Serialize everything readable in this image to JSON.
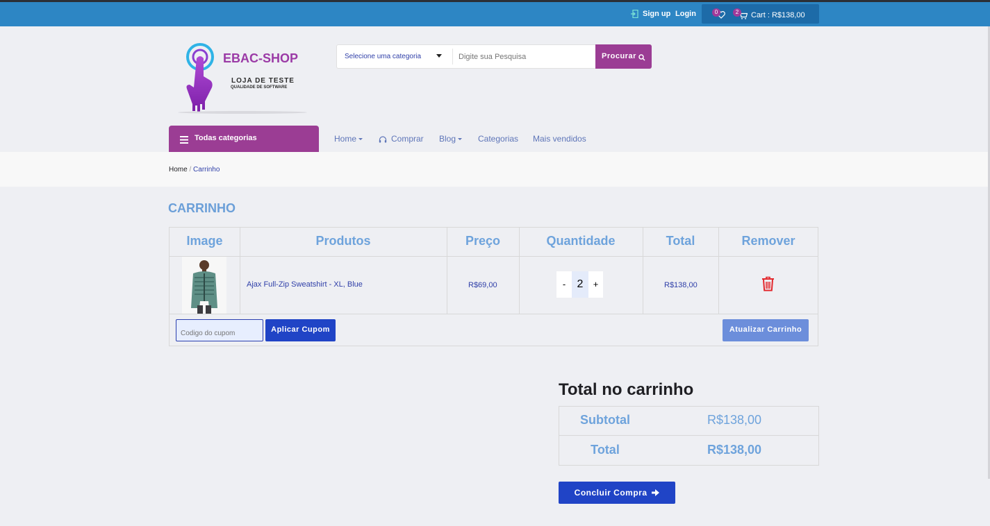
{
  "topbar": {
    "signup_label": "Sign up",
    "login_label": "Login",
    "wishlist_count": "0",
    "cart_count": "2",
    "cart_label": "Cart : R$138,00",
    "color": "#2d86c4"
  },
  "logo": {
    "brand": "EBAC-SHOP",
    "tagline": "LOJA DE TESTE",
    "subtagline": "QUALIDADE DE SOFTWARE"
  },
  "search": {
    "category_label": "Selecione uma categoria",
    "placeholder": "Digite sua Pesquisa",
    "button_label": "Procurar"
  },
  "nav": {
    "all_categories": "Todas categorias",
    "items": [
      "Home",
      "Comprar",
      "Blog",
      "Categorias",
      "Mais vendidos"
    ]
  },
  "breadcrumb": {
    "home": "Home",
    "separator": "/",
    "current": "Carrinho"
  },
  "cart": {
    "title": "CARRINHO",
    "columns": [
      "Image",
      "Produtos",
      "Preço",
      "Quantidade",
      "Total",
      "Remover"
    ],
    "rows": [
      {
        "product": "Ajax Full-Zip Sweatshirt - XL, Blue",
        "price": "R$69,00",
        "quantity": "2",
        "total": "R$138,00"
      }
    ],
    "qty_minus": "-",
    "qty_plus": "+",
    "coupon_placeholder": "Codigo do cupom",
    "apply_coupon": "Aplicar Cupom",
    "update_cart": "Atualizar Carrinho"
  },
  "totals": {
    "title": "Total no carrinho",
    "subtotal_label": "Subtotal",
    "subtotal_value": "R$138,00",
    "total_label": "Total",
    "total_value": "R$138,00",
    "checkout_label": "Concluir Compra"
  },
  "colors": {
    "accent_purple": "#9b3d94",
    "primary_blue": "#2044c6",
    "remove_red": "#e3262b"
  }
}
